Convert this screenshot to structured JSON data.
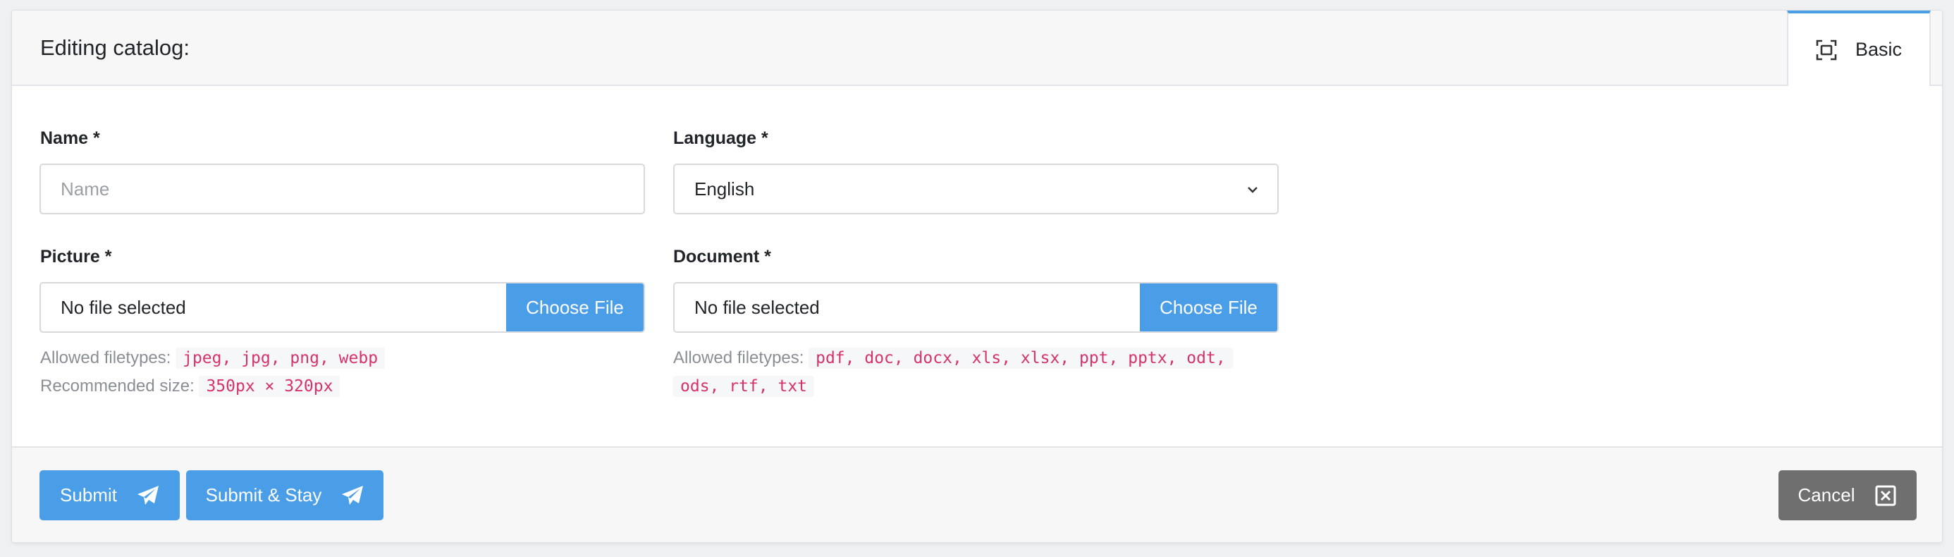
{
  "header": {
    "title": "Editing catalog:",
    "tab_label": "Basic",
    "tab_icon": "fullscreen-icon"
  },
  "form": {
    "name": {
      "label": "Name *",
      "placeholder": "Name",
      "value": ""
    },
    "language": {
      "label": "Language *",
      "selected": "English"
    },
    "picture": {
      "label": "Picture *",
      "status": "No file selected",
      "button": "Choose File",
      "allowed_label": "Allowed filetypes:",
      "allowed_types": "jpeg, jpg, png, webp",
      "size_label": "Recommended size:",
      "size_value": "350px × 320px"
    },
    "document": {
      "label": "Document *",
      "status": "No file selected",
      "button": "Choose File",
      "allowed_label": "Allowed filetypes:",
      "allowed_types_line1": "pdf, doc, docx, xls, xlsx, ppt, pptx, odt,",
      "allowed_types_line2": "ods, rtf, txt"
    }
  },
  "footer": {
    "submit": "Submit",
    "submit_stay": "Submit & Stay",
    "cancel": "Cancel"
  },
  "colors": {
    "accent": "#4a9ee8",
    "cancel": "#6f6f6f",
    "code": "#d6336c"
  }
}
